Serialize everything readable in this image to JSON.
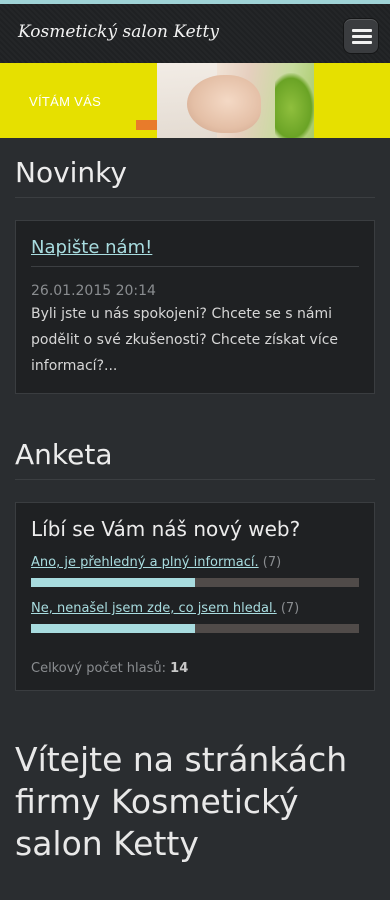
{
  "header": {
    "site_title": "Kosmetický salon Ketty",
    "menu_icon": "hamburger-menu-icon"
  },
  "banner": {
    "text": "VÍTÁM VÁS"
  },
  "news": {
    "title": "Novinky",
    "item": {
      "link": "Napište nám!",
      "date": "26.01.2015 20:14",
      "text": "Byli jste u nás spokojeni? Chcete se s námi podělit o své zkušenosti? Chcete získat více informací?..."
    }
  },
  "poll": {
    "title": "Anketa",
    "question": "Líbí se Vám náš nový web?",
    "options": [
      {
        "label": "Ano, je přehledný a plný informací.",
        "count": "(7)",
        "share": 0.5
      },
      {
        "label": "Ne, nenašel jsem zde, co jsem hledal.",
        "count": "(7)",
        "share": 0.5
      }
    ],
    "total_label": "Celkový počet hlasů:",
    "total_value": "14"
  },
  "welcome": {
    "heading": "Vítejte na stránkách firmy Kosmetický salon Ketty"
  },
  "colors": {
    "accent": "#a8dcdf",
    "banner_yellow": "#e6e000",
    "background": "#2a2d30"
  }
}
